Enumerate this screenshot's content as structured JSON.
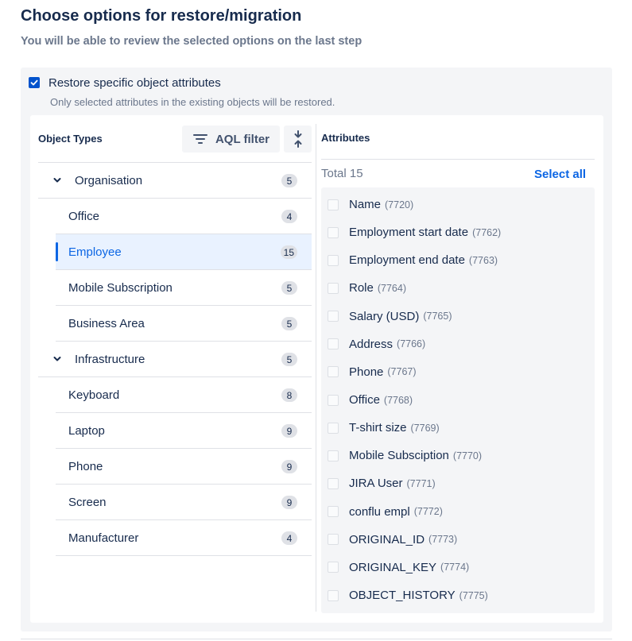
{
  "header": {
    "title": "Choose options for restore/migration",
    "subtitle": "You will be able to review the selected options on the last step"
  },
  "restore": {
    "label": "Restore specific object attributes",
    "hint": "Only selected attributes in the existing objects will be restored.",
    "checked": true
  },
  "object_types": {
    "header": "Object Types",
    "aql_filter_label": "AQL filter",
    "items": [
      {
        "label": "Organisation",
        "count": "5",
        "kind": "group"
      },
      {
        "label": "Office",
        "count": "4",
        "kind": "child"
      },
      {
        "label": "Employee",
        "count": "15",
        "kind": "child",
        "selected": true
      },
      {
        "label": "Mobile Subscription",
        "count": "5",
        "kind": "child"
      },
      {
        "label": "Business Area",
        "count": "5",
        "kind": "child"
      },
      {
        "label": "Infrastructure",
        "count": "5",
        "kind": "group"
      },
      {
        "label": "Keyboard",
        "count": "8",
        "kind": "child"
      },
      {
        "label": "Laptop",
        "count": "9",
        "kind": "child"
      },
      {
        "label": "Phone",
        "count": "9",
        "kind": "child"
      },
      {
        "label": "Screen",
        "count": "9",
        "kind": "child"
      },
      {
        "label": "Manufacturer",
        "count": "4",
        "kind": "child"
      }
    ]
  },
  "attributes": {
    "header": "Attributes",
    "total": "Total 15",
    "select_all_label": "Select all",
    "items": [
      {
        "name": "Name",
        "id": "(7720)"
      },
      {
        "name": "Employment start date",
        "id": "(7762)"
      },
      {
        "name": "Employment end date",
        "id": "(7763)"
      },
      {
        "name": "Role",
        "id": "(7764)"
      },
      {
        "name": "Salary (USD)",
        "id": "(7765)"
      },
      {
        "name": "Address",
        "id": "(7766)"
      },
      {
        "name": "Phone",
        "id": "(7767)"
      },
      {
        "name": "Office",
        "id": "(7768)"
      },
      {
        "name": "T-shirt size",
        "id": "(7769)"
      },
      {
        "name": "Mobile Subsciption",
        "id": "(7770)"
      },
      {
        "name": "JIRA User",
        "id": "(7771)"
      },
      {
        "name": "conflu empl",
        "id": "(7772)"
      },
      {
        "name": "ORIGINAL_ID",
        "id": "(7773)"
      },
      {
        "name": "ORIGINAL_KEY",
        "id": "(7774)"
      },
      {
        "name": "OBJECT_HISTORY",
        "id": "(7775)"
      }
    ]
  },
  "colors": {
    "accent": "#0c66e4",
    "checkbox": "#0052cc",
    "panel_bg": "#f4f5f7",
    "selected_bg": "#e9f2ff"
  },
  "icons": {
    "restore_checkbox": "checkmark-icon",
    "aql": "filter-icon",
    "collapse": "collapse-vertical-icon",
    "group_toggle": "chevron-down-icon"
  }
}
